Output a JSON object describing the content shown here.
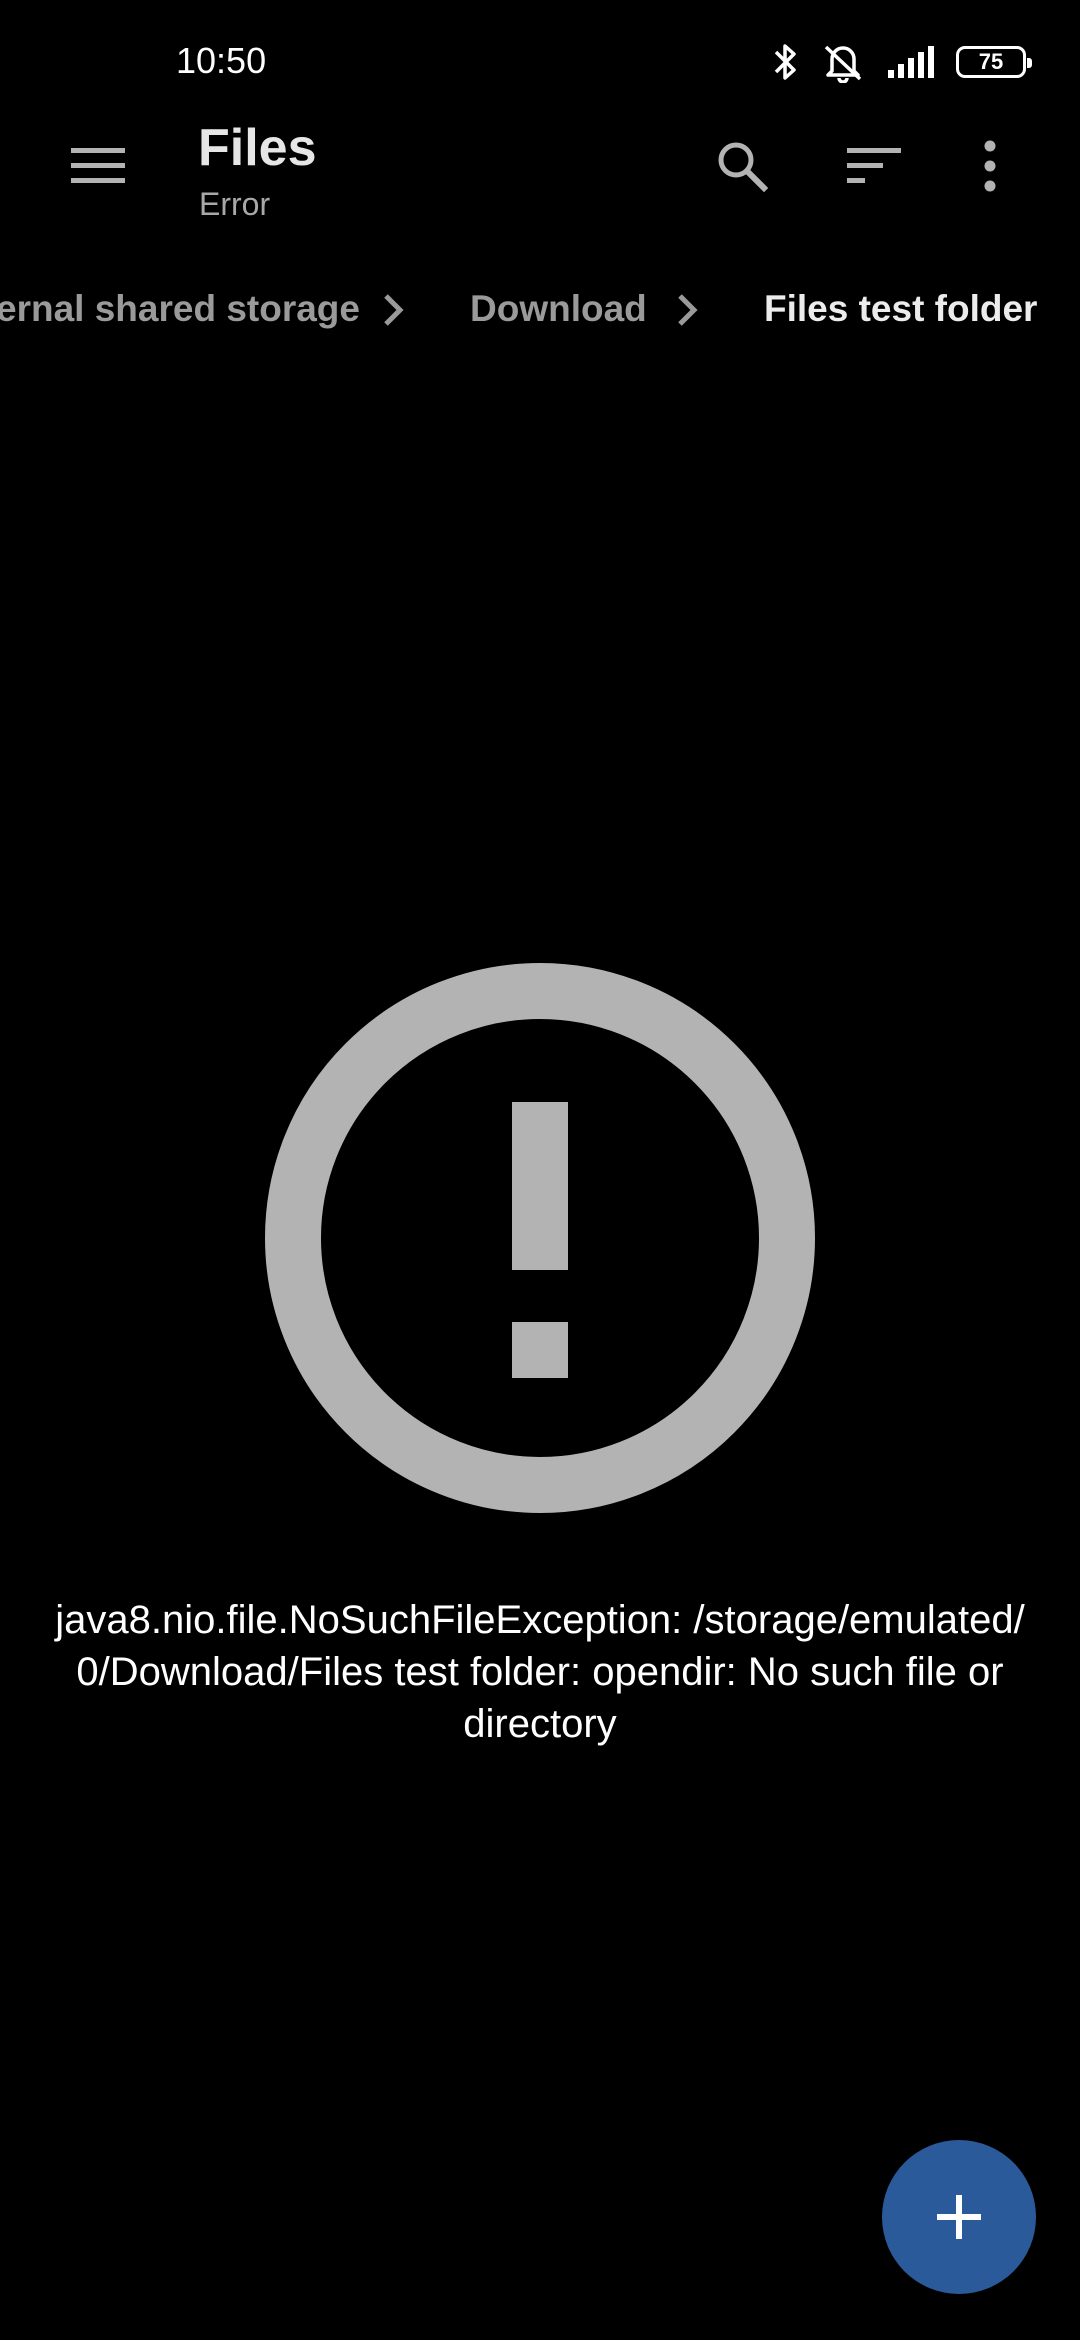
{
  "status_bar": {
    "time": "10:50",
    "battery_level": "75",
    "icons": [
      "bluetooth-icon",
      "muted-vibrate-icon",
      "signal-icon",
      "battery-icon"
    ]
  },
  "app_bar": {
    "title": "Files",
    "subtitle": "Error",
    "actions": [
      "menu-icon",
      "search-icon",
      "sort-icon",
      "more-vert-icon"
    ]
  },
  "breadcrumb": {
    "items": [
      "ernal shared storage",
      "Download",
      "Files test folder"
    ],
    "separator_icon": "chevron-right-icon"
  },
  "error": {
    "icon": "error-outline-icon",
    "message": "java8.nio.file.NoSuchFileException: /storage/emulated/\n0/Download/Files test folder: opendir: No such file or\ndirectory"
  },
  "fab": {
    "icon": "add-icon"
  },
  "colors": {
    "background": "#000000",
    "icon_gray": "#b3b3b3",
    "fab": "#2b5a9a",
    "text_primary": "#ffffff",
    "text_secondary": "#a8a8a8"
  }
}
